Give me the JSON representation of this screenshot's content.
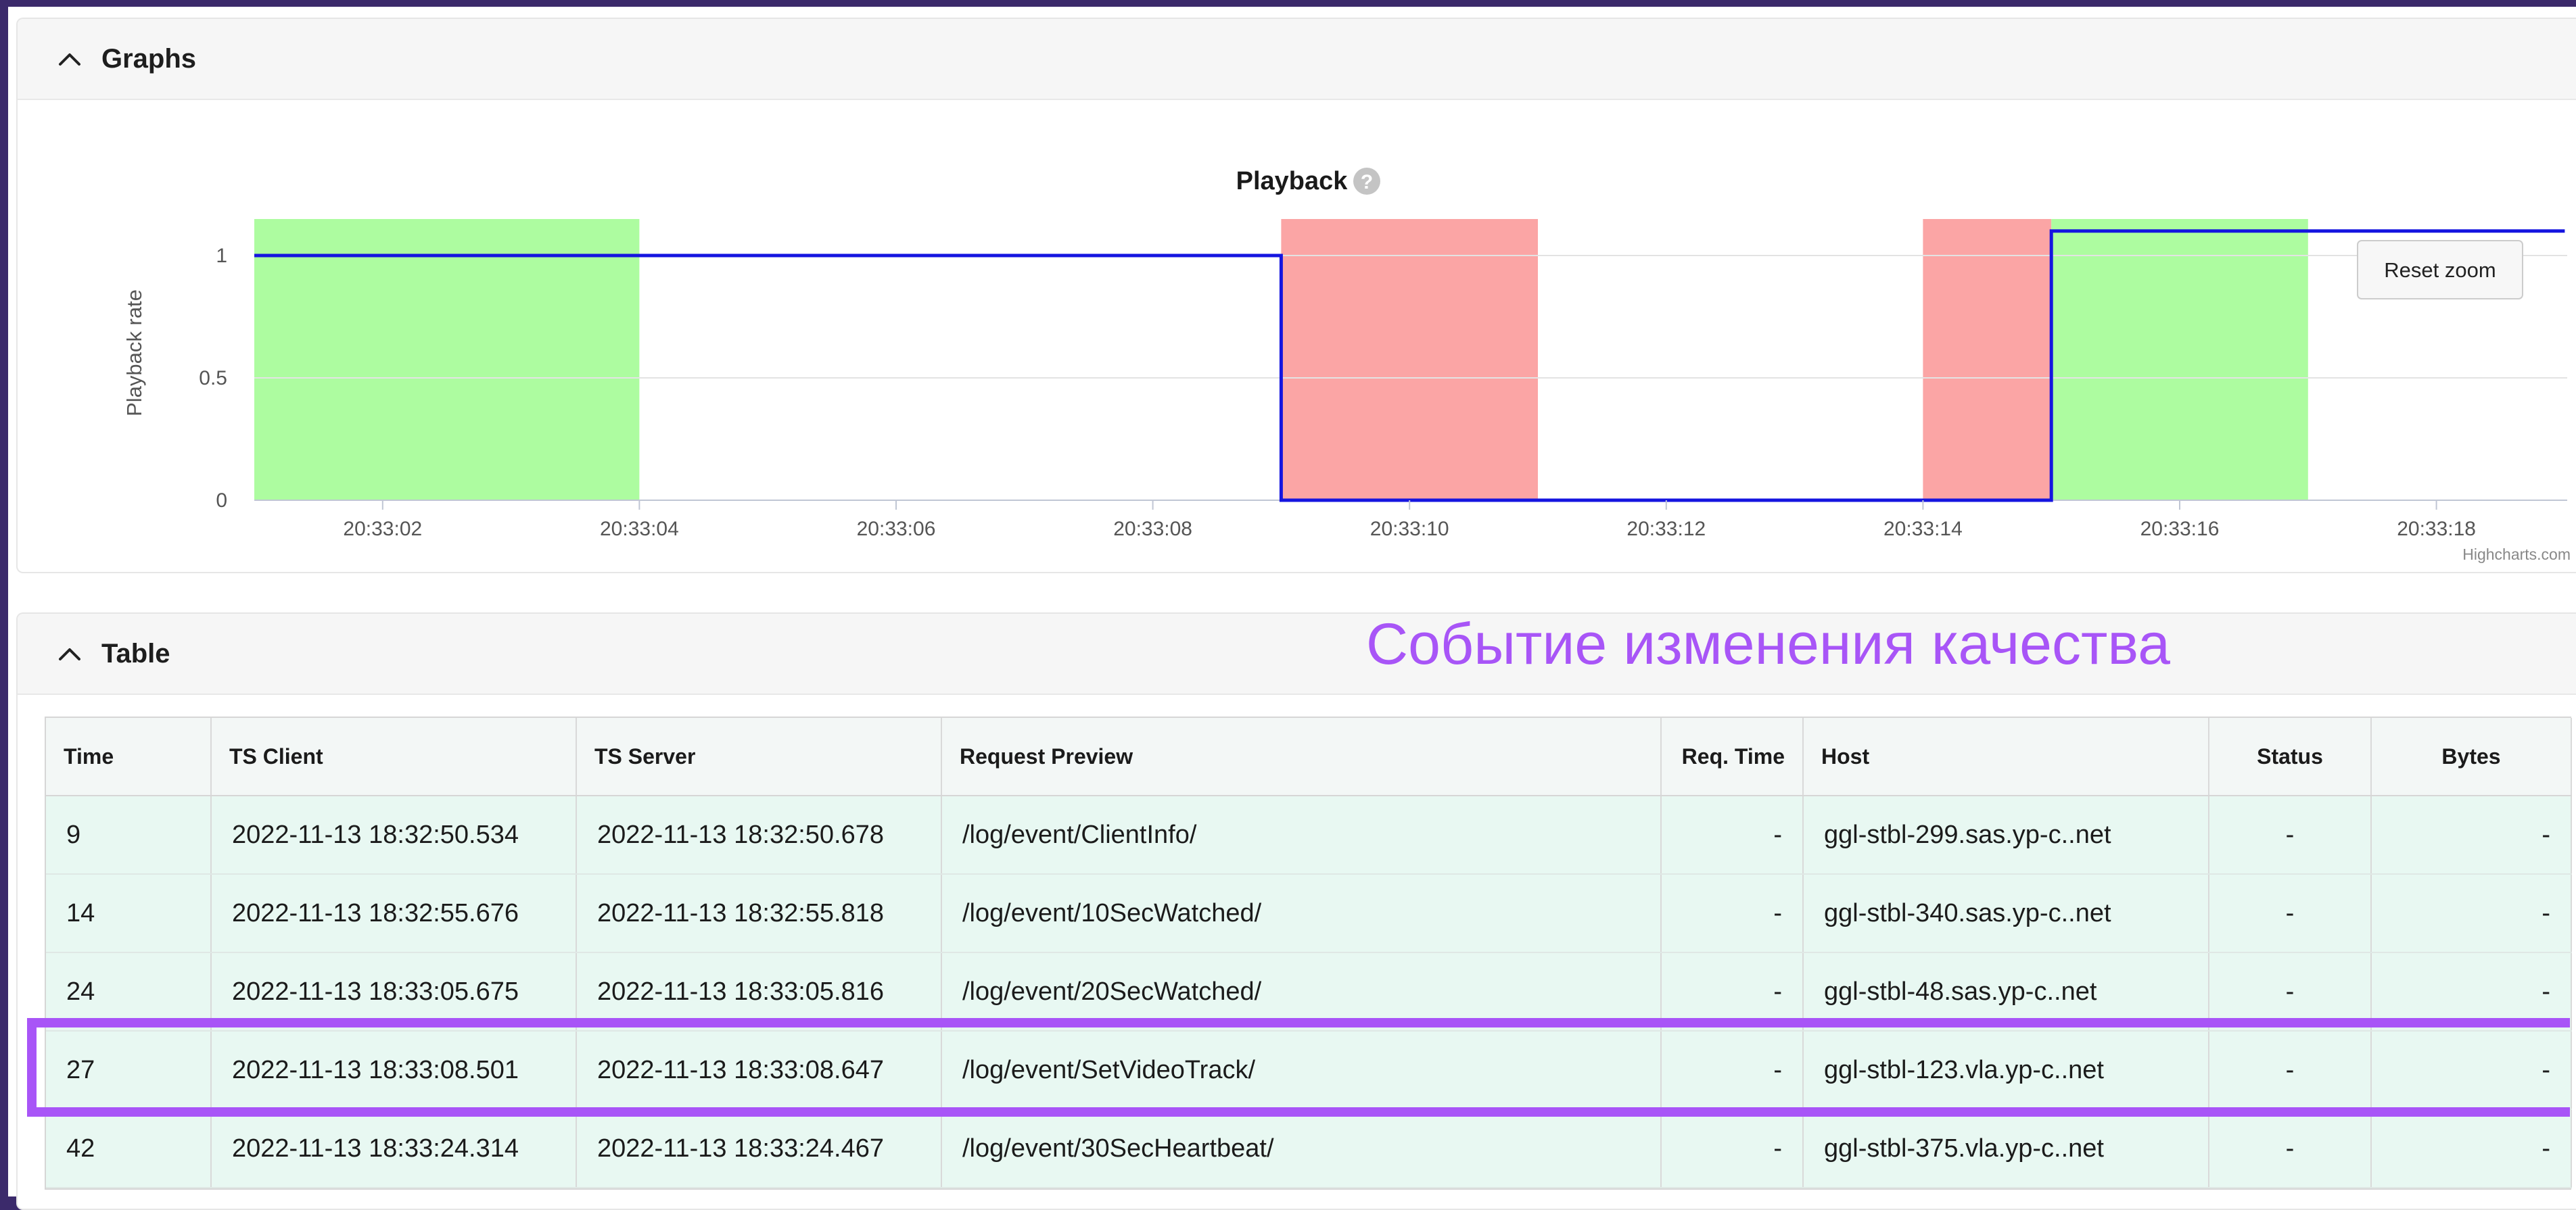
{
  "graphs": {
    "title": "Graphs",
    "reset_zoom": "Reset zoom",
    "credits": "Highcharts.com"
  },
  "chart_data": {
    "type": "line",
    "title": "Playback",
    "ylabel": "Playback rate",
    "xlabel": "",
    "ylim": [
      0,
      1.15
    ],
    "yticks": [
      "0",
      "0.5",
      "1"
    ],
    "xlim_seconds": [
      61,
      79
    ],
    "xticks": [
      "20:33:02",
      "20:33:04",
      "20:33:06",
      "20:33:08",
      "20:33:10",
      "20:33:12",
      "20:33:14",
      "20:33:16",
      "20:33:18"
    ],
    "series": [
      {
        "step": true,
        "color": "#1515e0",
        "points": [
          [
            61,
            1
          ],
          [
            69,
            1
          ],
          [
            69,
            0
          ],
          [
            75,
            0
          ],
          [
            75,
            1.1
          ],
          [
            79,
            1.1
          ]
        ]
      }
    ],
    "bands": [
      {
        "from": 61,
        "to": 64,
        "color": "#adfca0"
      },
      {
        "from": 69,
        "to": 71,
        "color": "#fba5a5"
      },
      {
        "from": 74,
        "to": 75,
        "color": "#fba5a5"
      },
      {
        "from": 75,
        "to": 77,
        "color": "#adfca0"
      }
    ]
  },
  "table": {
    "title": "Table",
    "annotation": "Событие изменения качества",
    "columns": [
      "Time",
      "TS Client",
      "TS Server",
      "Request Preview",
      "Req. Time",
      "Host",
      "Status",
      "Bytes"
    ],
    "rows": [
      [
        "9",
        "2022-11-13 18:32:50.534",
        "2022-11-13 18:32:50.678",
        "/log/event/ClientInfo/",
        "-",
        "ggl-stbl-299.sas.yp-c..net",
        "-",
        "-"
      ],
      [
        "14",
        "2022-11-13 18:32:55.676",
        "2022-11-13 18:32:55.818",
        "/log/event/10SecWatched/",
        "-",
        "ggl-stbl-340.sas.yp-c..net",
        "-",
        "-"
      ],
      [
        "24",
        "2022-11-13 18:33:05.675",
        "2022-11-13 18:33:05.816",
        "/log/event/20SecWatched/",
        "-",
        "ggl-stbl-48.sas.yp-c..net",
        "-",
        "-"
      ],
      [
        "27",
        "2022-11-13 18:33:08.501",
        "2022-11-13 18:33:08.647",
        "/log/event/SetVideoTrack/",
        "-",
        "ggl-stbl-123.vla.yp-c..net",
        "-",
        "-"
      ],
      [
        "42",
        "2022-11-13 18:33:24.314",
        "2022-11-13 18:33:24.467",
        "/log/event/30SecHeartbeat/",
        "-",
        "ggl-stbl-375.vla.yp-c..net",
        "-",
        "-"
      ]
    ]
  }
}
